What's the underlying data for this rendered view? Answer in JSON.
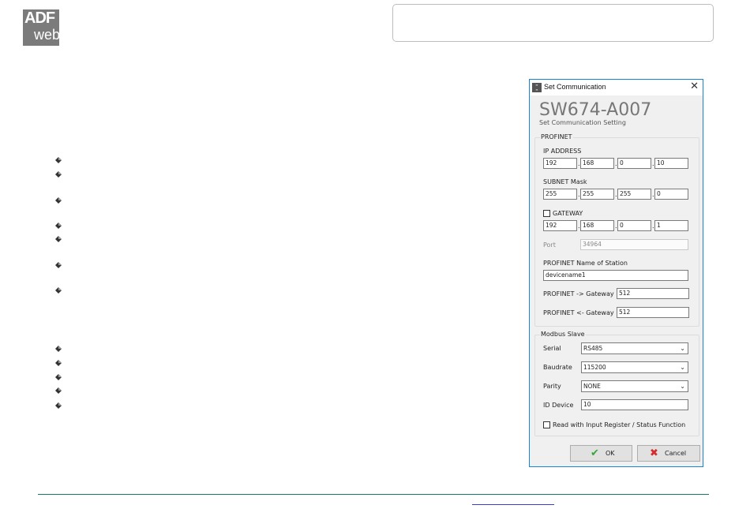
{
  "logo": {
    "line1": "ADF",
    "line2": "web"
  },
  "dialog": {
    "title": "Set Communication",
    "product": "SW674-A007",
    "subtitle": "Set Communication Setting",
    "profinet": {
      "group_label": "PROFINET",
      "ip_label": "IP ADDRESS",
      "ip": [
        "192",
        "168",
        "0",
        "10"
      ],
      "mask_label": "SUBNET Mask",
      "mask": [
        "255",
        "255",
        "255",
        "0"
      ],
      "gateway_label": "GATEWAY",
      "gateway_checked": false,
      "gateway": [
        "192",
        "168",
        "0",
        "1"
      ],
      "port_label": "Port",
      "port": "34964",
      "station_label": "PROFINET Name of Station",
      "station": "devicename1",
      "to_gw_label": "PROFINET -> Gateway",
      "to_gw": "512",
      "from_gw_label": "PROFINET <- Gateway",
      "from_gw": "512"
    },
    "modbus": {
      "group_label": "Modbus Slave",
      "serial_label": "Serial",
      "serial": "RS485",
      "baud_label": "Baudrate",
      "baud": "115200",
      "parity_label": "Parity",
      "parity": "NONE",
      "id_label": "ID Device",
      "id": "10",
      "read_input_label": "Read with Input Register / Status Function",
      "read_input_checked": false
    },
    "ok_label": "OK",
    "cancel_label": "Cancel"
  },
  "icons": {
    "ok": "check-icon",
    "cancel": "cross-icon",
    "close": "close-icon",
    "bullet": "bullet-icon"
  },
  "colors": {
    "dialog_border": "#1883d7",
    "footer_line": "#0f7a6e",
    "link": "#3a3ad6"
  }
}
